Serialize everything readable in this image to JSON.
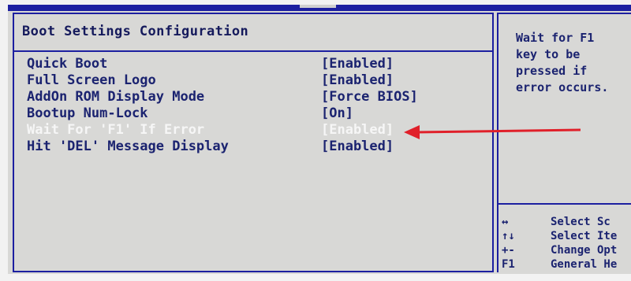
{
  "title": "Boot Settings Configuration",
  "settings": [
    {
      "name": "Quick Boot",
      "value": "[Enabled]",
      "selected": false
    },
    {
      "name": "Full Screen Logo",
      "value": "[Enabled]",
      "selected": false
    },
    {
      "name": "AddOn ROM Display Mode",
      "value": "[Force BIOS]",
      "selected": false
    },
    {
      "name": "Bootup Num-Lock",
      "value": "[On]",
      "selected": false
    },
    {
      "name": "Wait For 'F1' If Error",
      "value": "[Enabled]",
      "selected": true
    },
    {
      "name": "Hit 'DEL' Message Display",
      "value": "[Enabled]",
      "selected": false
    }
  ],
  "help": {
    "lines": [
      "Wait for F1",
      "key to be",
      "pressed if",
      "error occurs."
    ]
  },
  "keys": [
    {
      "key": "↔",
      "desc": "Select Sc"
    },
    {
      "key": "↑↓",
      "desc": "Select Ite"
    },
    {
      "key": "+-",
      "desc": "Change Opt"
    },
    {
      "key": "F1",
      "desc": "General He"
    }
  ],
  "colors": {
    "background": "#d8d8d6",
    "border": "#1c1fa0",
    "text": "#1b2370",
    "selected_text": "#f6f6f6",
    "annotation_arrow": "#e0202a"
  }
}
